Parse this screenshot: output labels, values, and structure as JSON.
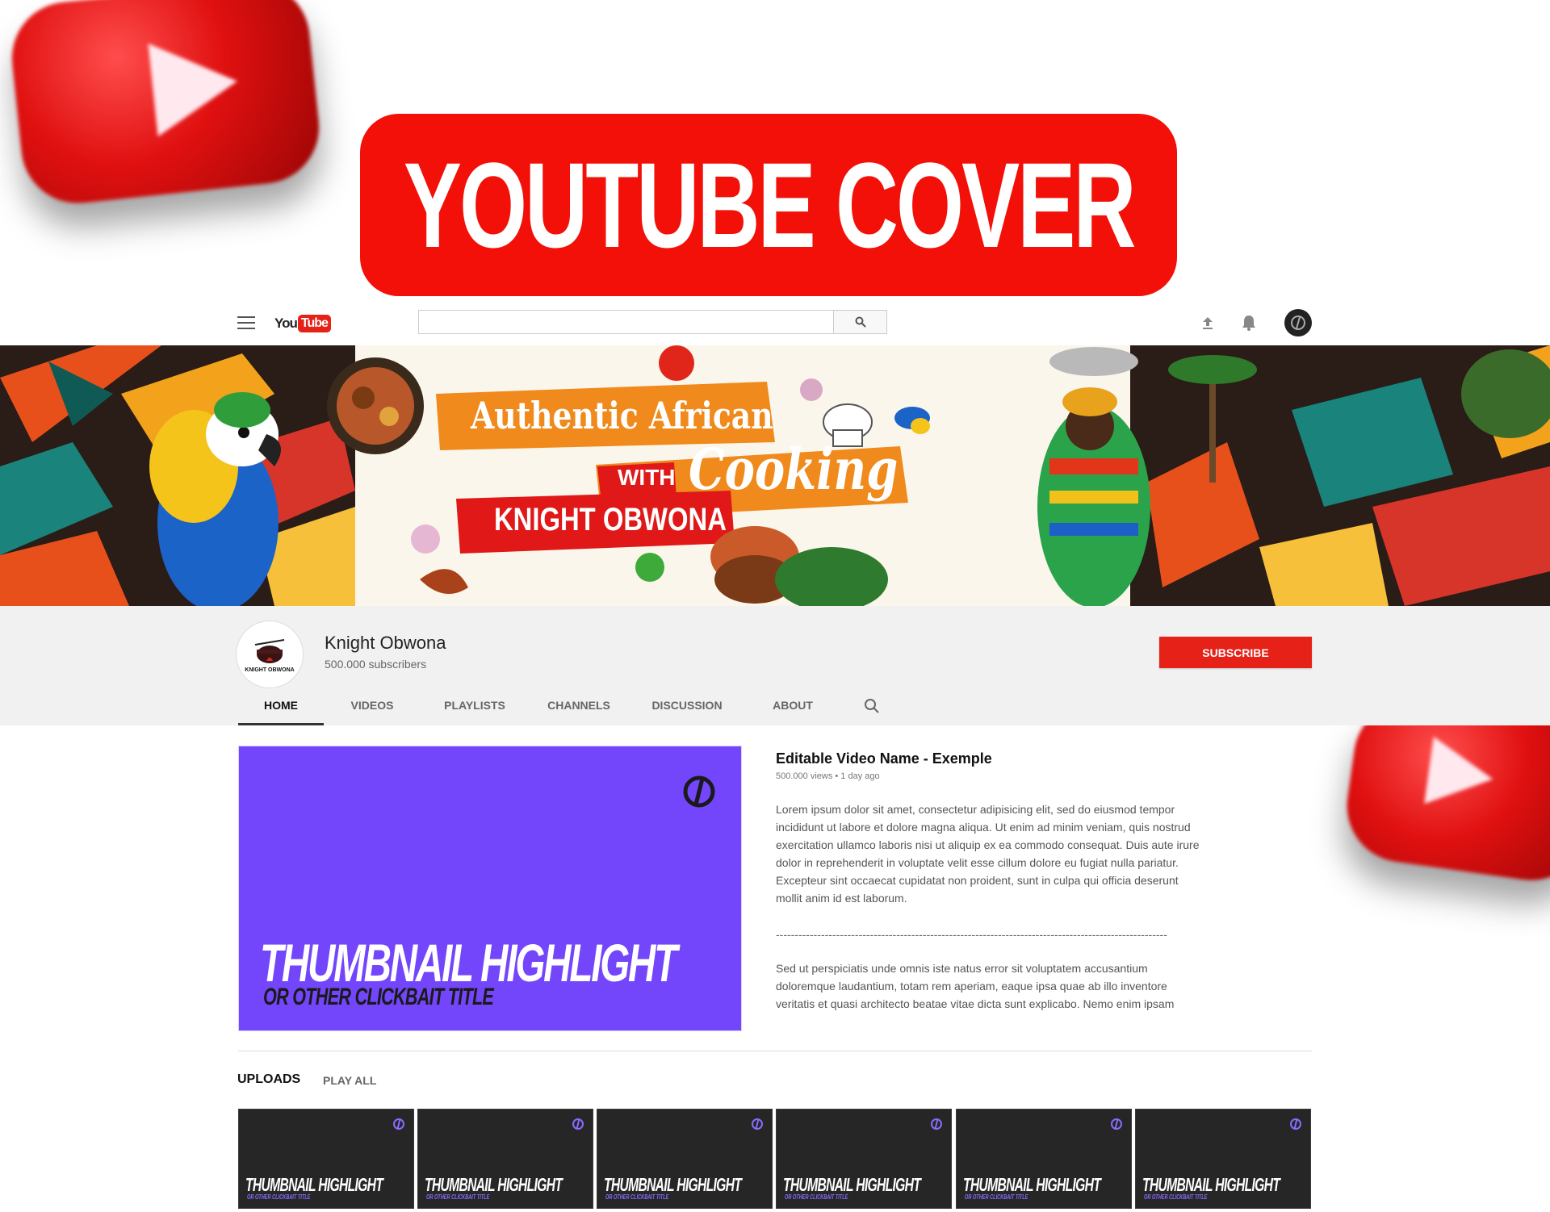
{
  "hero": {
    "title": "YOUTUBE COVER"
  },
  "masthead": {
    "logo_you": "You",
    "logo_tube": "Tube",
    "search_placeholder": "",
    "icons": [
      "menu-icon",
      "search-icon",
      "upload-icon",
      "bell-icon",
      "avatar"
    ]
  },
  "banner": {
    "line1": "Authentic African",
    "with": "WITH",
    "cooking": "Cooking",
    "name": "KNIGHT OBWONA"
  },
  "channel": {
    "name": "Knight Obwona",
    "subscribers": "500.000 subscribers",
    "avatar_text": "KNIGHT OBWONA",
    "subscribe_label": "SUBSCRIBE",
    "tabs": [
      {
        "label": "HOME"
      },
      {
        "label": "VIDEOS"
      },
      {
        "label": "PLAYLISTS"
      },
      {
        "label": "CHANNELS"
      },
      {
        "label": "DISCUSSION"
      },
      {
        "label": "ABOUT"
      }
    ]
  },
  "featured": {
    "thumb_title": "THUMBNAIL HIGHLIGHT",
    "thumb_sub": "OR OTHER CLICKBAIT TITLE",
    "title": "Editable Video Name - Exemple",
    "meta": "500.000 views • 1 day ago",
    "desc1": "Lorem ipsum dolor sit amet, consectetur adipisicing elit, sed do eiusmod tempor incididunt ut labore et dolore magna aliqua. Ut enim ad minim veniam, quis nostrud exercitation ullamco laboris nisi ut aliquip ex ea commodo consequat. Duis aute irure dolor in reprehenderit in voluptate velit esse cillum dolore eu fugiat nulla pariatur. Excepteur sint occaecat cupidatat non proident, sunt in culpa qui officia deserunt mollit anim id est laborum.",
    "divider": "--------------------------------------------------------------------------------------------------------",
    "desc2": "Sed ut perspiciatis unde omnis iste natus error sit voluptatem accusantium doloremque laudantium, totam rem aperiam, eaque ipsa quae ab illo inventore veritatis et quasi architecto beatae vitae dicta sunt explicabo. Nemo enim ipsam"
  },
  "uploads": {
    "label": "UPLOADS",
    "play_all": "PLAY ALL",
    "items": [
      {
        "title": "THUMBNAIL HIGHLIGHT",
        "sub": "OR OTHER CLICKBAIT TITLE"
      },
      {
        "title": "THUMBNAIL HIGHLIGHT",
        "sub": "OR OTHER CLICKBAIT TITLE"
      },
      {
        "title": "THUMBNAIL HIGHLIGHT",
        "sub": "OR OTHER CLICKBAIT TITLE"
      },
      {
        "title": "THUMBNAIL HIGHLIGHT",
        "sub": "OR OTHER CLICKBAIT TITLE"
      },
      {
        "title": "THUMBNAIL HIGHLIGHT",
        "sub": "OR OTHER CLICKBAIT TITLE"
      },
      {
        "title": "THUMBNAIL HIGHLIGHT",
        "sub": "OR OTHER CLICKBAIT TITLE"
      }
    ]
  },
  "colors": {
    "youtube_red": "#e62117",
    "hero_red": "#f21008",
    "thumb_purple": "#7346fb",
    "thumb_dark": "#262626"
  }
}
